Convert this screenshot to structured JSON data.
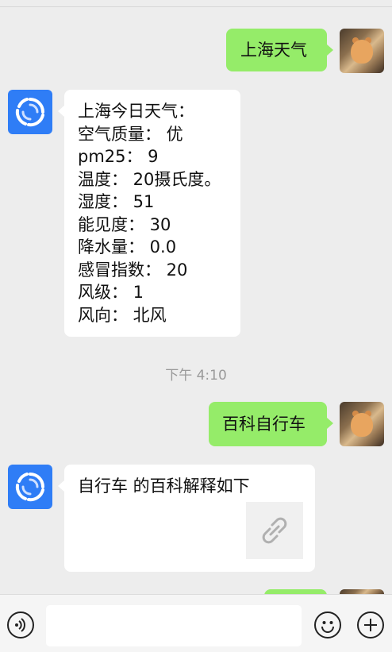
{
  "messages": [
    {
      "sender": "user",
      "text": "上海天气"
    },
    {
      "sender": "bot",
      "lines": [
        "上海今日天气：",
        "空气质量：  优",
        "pm25：  9",
        "温度：  20摄氏度。",
        "湿度：  51",
        "能见度：  30",
        "降水量：  0.0",
        "感冒指数：  20",
        "风级：  1",
        "风向：  北风"
      ]
    },
    {
      "sender": "user",
      "text": "百科自行车"
    },
    {
      "sender": "bot",
      "text": "自行车 的百科解释如下",
      "has_link_thumbnail": true
    }
  ],
  "timestamp": "下午 4:10",
  "input": {
    "value": "",
    "placeholder": ""
  },
  "icons": {
    "bot_avatar": "swirl-logo-icon",
    "user_avatar": "hamster-photo",
    "link": "link-icon",
    "voice": "voice-icon",
    "emoji": "emoji-icon",
    "add": "plus-icon"
  },
  "colors": {
    "background": "#ededed",
    "sent_bubble": "#95ec69",
    "received_bubble": "#ffffff",
    "bot_avatar_bg": "#2f7df6"
  }
}
